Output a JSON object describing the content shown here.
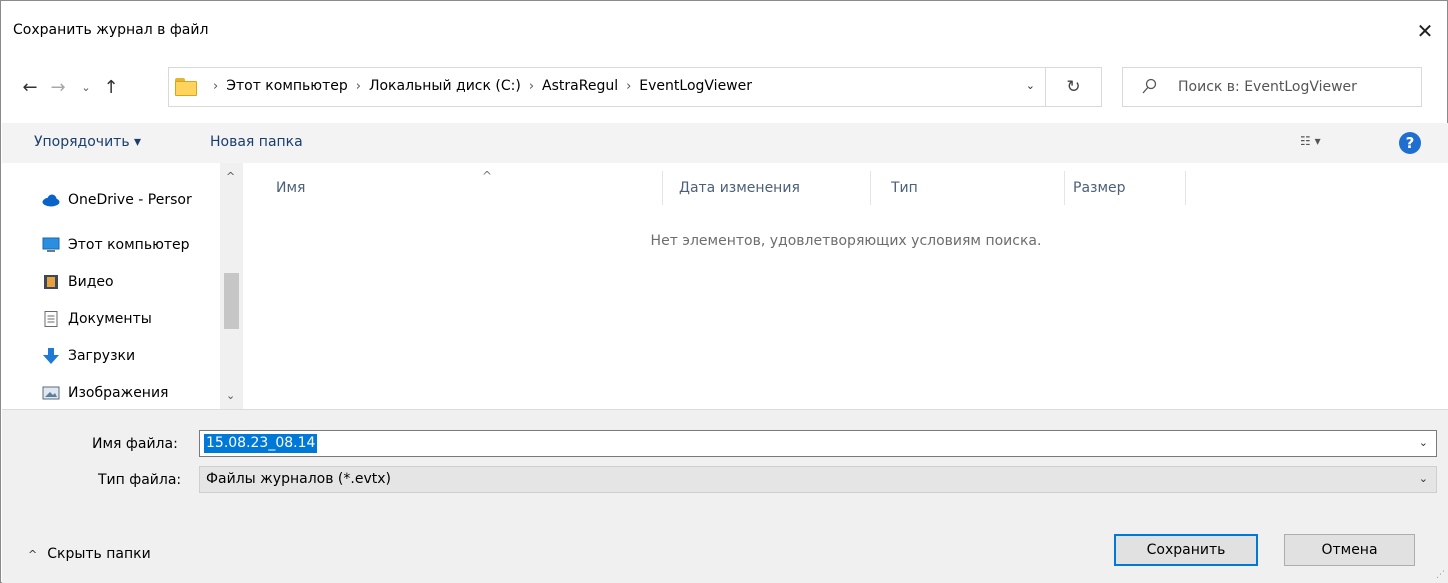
{
  "dialog": {
    "title": "Сохранить журнал в файл",
    "close_glyph": "✕"
  },
  "navigation": {
    "back_glyph": "←",
    "forward_glyph": "→",
    "recent_glyph": "⌄",
    "up_glyph": "↑"
  },
  "address": {
    "crumbs": [
      "Этот компьютер",
      "Локальный диск (C:)",
      "AstraRegul",
      "EventLogViewer"
    ],
    "separator": "›",
    "dropdown_glyph": "⌄",
    "refresh_glyph": "↻"
  },
  "search": {
    "placeholder": "Поиск в: EventLogViewer"
  },
  "toolbar": {
    "organize_label": "Упорядочить ▾",
    "new_folder_label": "Новая папка",
    "view_glyph": "☷ ▾",
    "help_glyph": "?"
  },
  "nav_pane": {
    "items": [
      {
        "label": "OneDrive - Persor",
        "icon": "cloud-icon"
      },
      {
        "label": "Этот компьютер",
        "icon": "computer-icon"
      },
      {
        "label": "Видео",
        "icon": "video-icon"
      },
      {
        "label": "Документы",
        "icon": "documents-icon"
      },
      {
        "label": "Загрузки",
        "icon": "download-icon"
      },
      {
        "label": "Изображения",
        "icon": "pictures-icon"
      }
    ],
    "scroll_up_glyph": "^",
    "scroll_down_glyph": "⌄"
  },
  "file_list": {
    "columns": [
      "Имя",
      "Дата изменения",
      "Тип",
      "Размер"
    ],
    "sort_glyph": "^",
    "empty_message": "Нет элементов, удовлетворяющих условиям поиска."
  },
  "form": {
    "filename_label": "Имя файла:",
    "filename_value": "15.08.23_08.14",
    "filetype_label": "Тип файла:",
    "filetype_value": "Файлы журналов (*.evtx)",
    "dropdown_glyph": "⌄"
  },
  "footer": {
    "hide_folders_label": "Скрыть папки",
    "hide_folders_glyph": "^",
    "save_label": "Сохранить",
    "cancel_label": "Отмена"
  },
  "colors": {
    "accent": "#0078d7",
    "link": "#1a3e6e",
    "help": "#1f6fd1"
  }
}
